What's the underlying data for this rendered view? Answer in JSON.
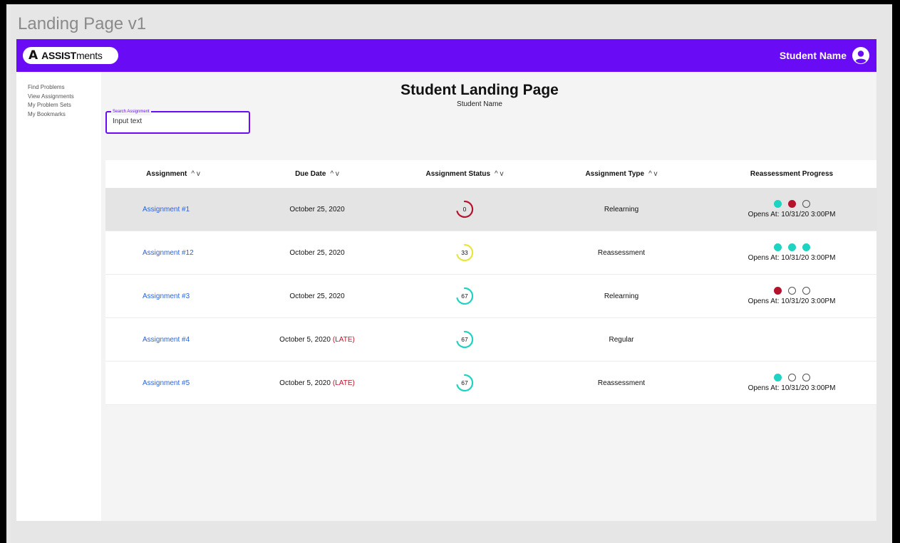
{
  "page_title": "Landing Page v1",
  "brand": {
    "logo_mark": "A",
    "logo_strong": "ASSIST",
    "logo_light": "ments"
  },
  "user": {
    "name": "Student Name",
    "icon": "user-circle-icon"
  },
  "sidebar": {
    "items": [
      "Find Problems",
      "View Assignments",
      "My Problem Sets",
      "My Bookmarks"
    ]
  },
  "main": {
    "title": "Student Landing Page",
    "subtitle": "Student Name"
  },
  "search": {
    "label": "Search Assignment",
    "value": "Input text"
  },
  "table": {
    "columns": [
      {
        "label": "Assignment",
        "sortable": true
      },
      {
        "label": "Due Date",
        "sortable": true
      },
      {
        "label": "Assignment Status",
        "sortable": true
      },
      {
        "label": "Assignment Type",
        "sortable": true
      },
      {
        "label": "Reassessment Progress",
        "sortable": false
      }
    ],
    "sort_glyph": "^ v",
    "rows": [
      {
        "name": "Assignment #1",
        "due": "October 25, 2020",
        "late": "",
        "status": "0",
        "status_color": "#b5122b",
        "type": "Relearning",
        "progress": [
          "teal",
          "red",
          "empty"
        ],
        "opens": "Opens At: 10/31/20 3:00PM",
        "highlight": true
      },
      {
        "name": "Assignment #12",
        "due": "October 25, 2020",
        "late": "",
        "status": "33",
        "status_color": "#e8e63a",
        "type": "Reassessment",
        "progress": [
          "teal",
          "teal",
          "teal"
        ],
        "opens": "Opens At: 10/31/20 3:00PM",
        "highlight": false
      },
      {
        "name": "Assignment #3",
        "due": "October 25, 2020",
        "late": "",
        "status": "67",
        "status_color": "#1dd3c2",
        "type": "Relearning",
        "progress": [
          "red",
          "empty",
          "empty"
        ],
        "opens": "Opens At: 10/31/20 3:00PM",
        "highlight": false
      },
      {
        "name": "Assignment #4",
        "due": "October 5, 2020",
        "late": "(LATE)",
        "status": "67",
        "status_color": "#1dd3c2",
        "type": "Regular",
        "progress": [],
        "opens": "",
        "highlight": false
      },
      {
        "name": "Assignment #5",
        "due": "October 5, 2020",
        "late": "(LATE)",
        "status": "67",
        "status_color": "#1dd3c2",
        "type": "Reassessment",
        "progress": [
          "teal",
          "empty",
          "empty"
        ],
        "opens": "Opens At: 10/31/20 3:00PM",
        "highlight": false
      }
    ]
  },
  "colors": {
    "brand": "#6a0bf5",
    "link": "#2b62d9",
    "late": "#c0122b",
    "teal": "#1dd3c2",
    "red": "#b5122b"
  }
}
